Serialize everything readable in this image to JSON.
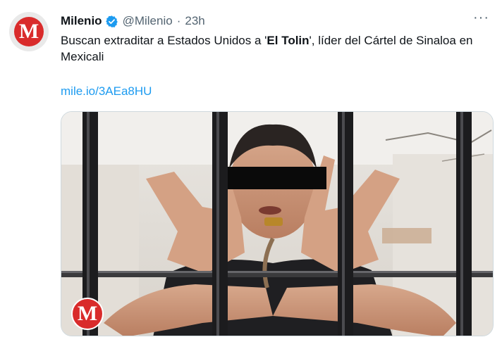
{
  "tweet": {
    "author_name": "Milenio",
    "handle": "@Milenio",
    "separator": "·",
    "time": "23h",
    "more": "···",
    "avatar_letter": "M",
    "text_before": "Buscan extraditar a Estados Unidos a '",
    "text_bold": "El Tolin",
    "text_after": "', líder del Cártel de Sinaloa en Mexicali",
    "link": "mile.io/3AEa8HU",
    "watermark_letter": "M"
  },
  "colors": {
    "brand": "#d92b2b",
    "link": "#1d9bf0",
    "verified": "#1d9bf0",
    "muted": "#536471"
  },
  "icons": {
    "verified": "verified-badge-icon",
    "more": "more-options-icon"
  }
}
